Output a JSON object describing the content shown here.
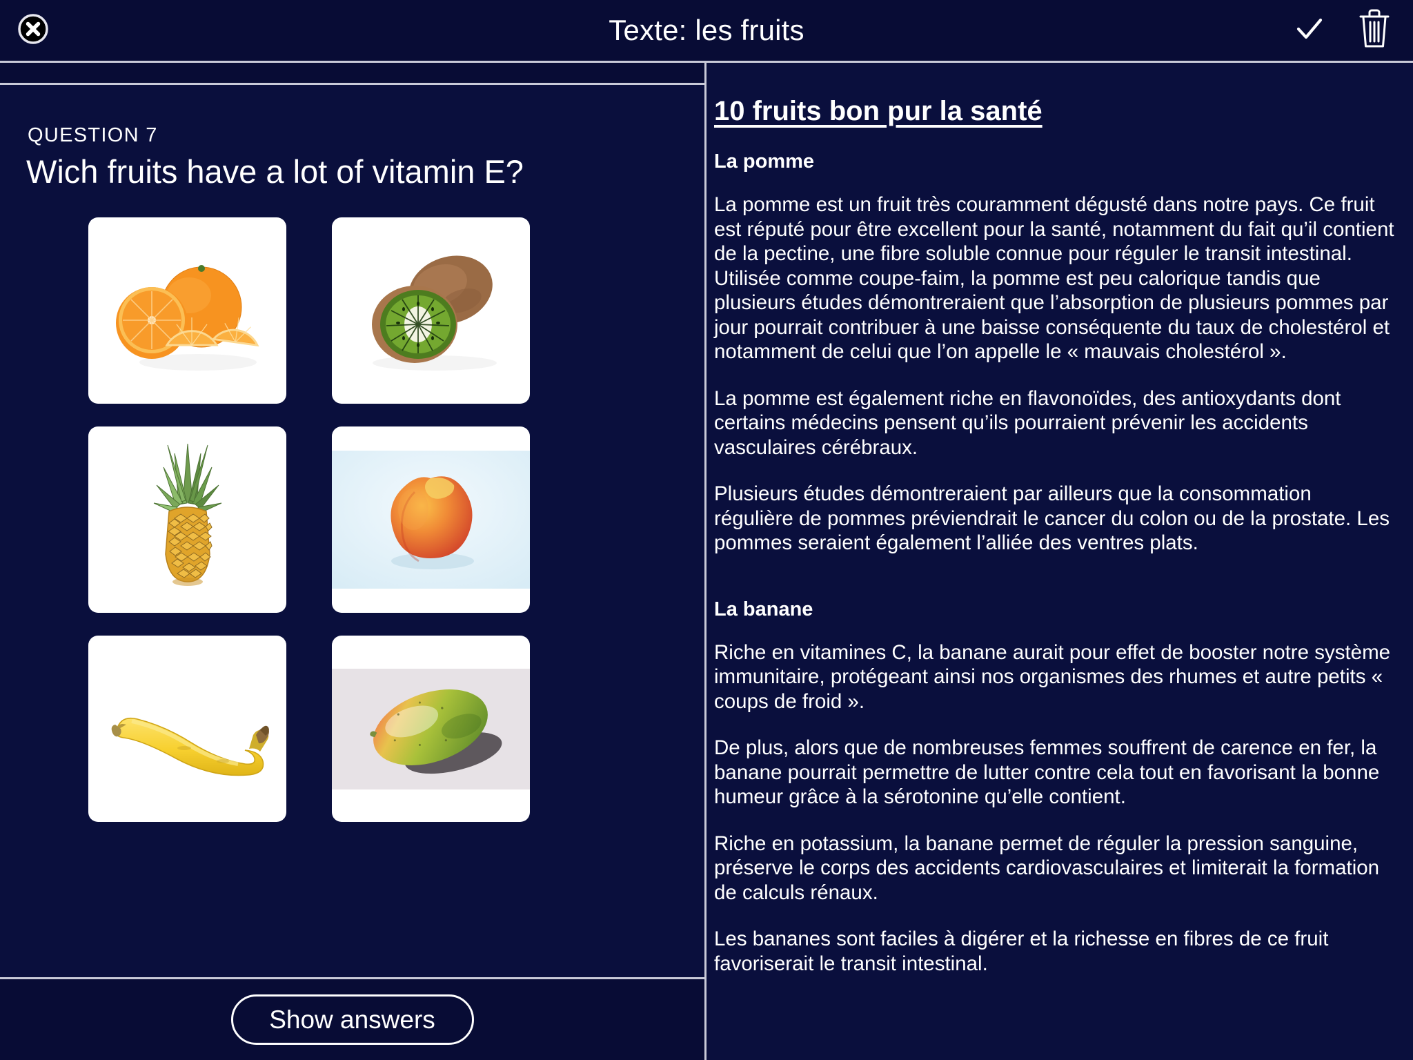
{
  "header": {
    "title": "Texte: les fruits",
    "close_icon": "close-circle-icon",
    "confirm_icon": "check-icon",
    "delete_icon": "trash-icon"
  },
  "question": {
    "label": "QUESTION 7",
    "text": "Wich fruits have a lot of vitamin E?",
    "options": [
      {
        "name": "orange",
        "alt": "orange"
      },
      {
        "name": "kiwi",
        "alt": "kiwi"
      },
      {
        "name": "pineapple",
        "alt": "pineapple"
      },
      {
        "name": "peach",
        "alt": "peach"
      },
      {
        "name": "banana",
        "alt": "banana"
      },
      {
        "name": "mango",
        "alt": "mango"
      }
    ],
    "show_answers_label": "Show answers"
  },
  "document": {
    "title": "10 fruits bon pur la santé",
    "sections": [
      {
        "heading": "La pomme",
        "paragraphs": [
          "La pomme est un fruit très couramment dégusté dans notre pays. Ce fruit est réputé pour être excellent pour la santé, notamment du fait qu’il contient de la pectine, une fibre soluble connue pour réguler le transit intestinal. Utilisée comme coupe-faim, la pomme est peu calorique tandis que plusieurs études démontreraient que l’absorption de plusieurs pommes par jour pourrait contribuer à une baisse conséquente du taux de cholestérol et notamment de celui que l’on appelle le « mauvais cholestérol ».",
          "La pomme est également riche en flavonoïdes, des antioxydants dont certains médecins pensent qu’ils pourraient prévenir les accidents vasculaires cérébraux.",
          "Plusieurs études démontreraient par ailleurs que la consommation régulière de pommes préviendrait le cancer du colon ou de la prostate. Les pommes seraient également l’alliée des ventres plats."
        ]
      },
      {
        "heading": "La banane",
        "paragraphs": [
          "Riche en vitamines C, la banane aurait pour effet de booster notre système immunitaire, protégeant ainsi nos organismes des rhumes et autre petits « coups de froid ».",
          "De plus, alors que de nombreuses femmes souffrent de carence en fer, la banane pourrait permettre de lutter contre cela tout en favorisant la bonne humeur grâce à la sérotonine qu’elle contient.",
          "Riche en potassium, la banane permet de réguler la pression sanguine, préserve le corps des accidents cardiovasculaires et limiterait la formation de calculs rénaux.",
          "Les bananes sont faciles à digérer et la richesse en fibres de ce fruit favoriserait le transit intestinal."
        ]
      }
    ]
  },
  "colors": {
    "background": "#080c35",
    "panel": "#0a0f3d",
    "divider": "#c9cad8",
    "text": "#ffffff",
    "tile": "#ffffff"
  }
}
